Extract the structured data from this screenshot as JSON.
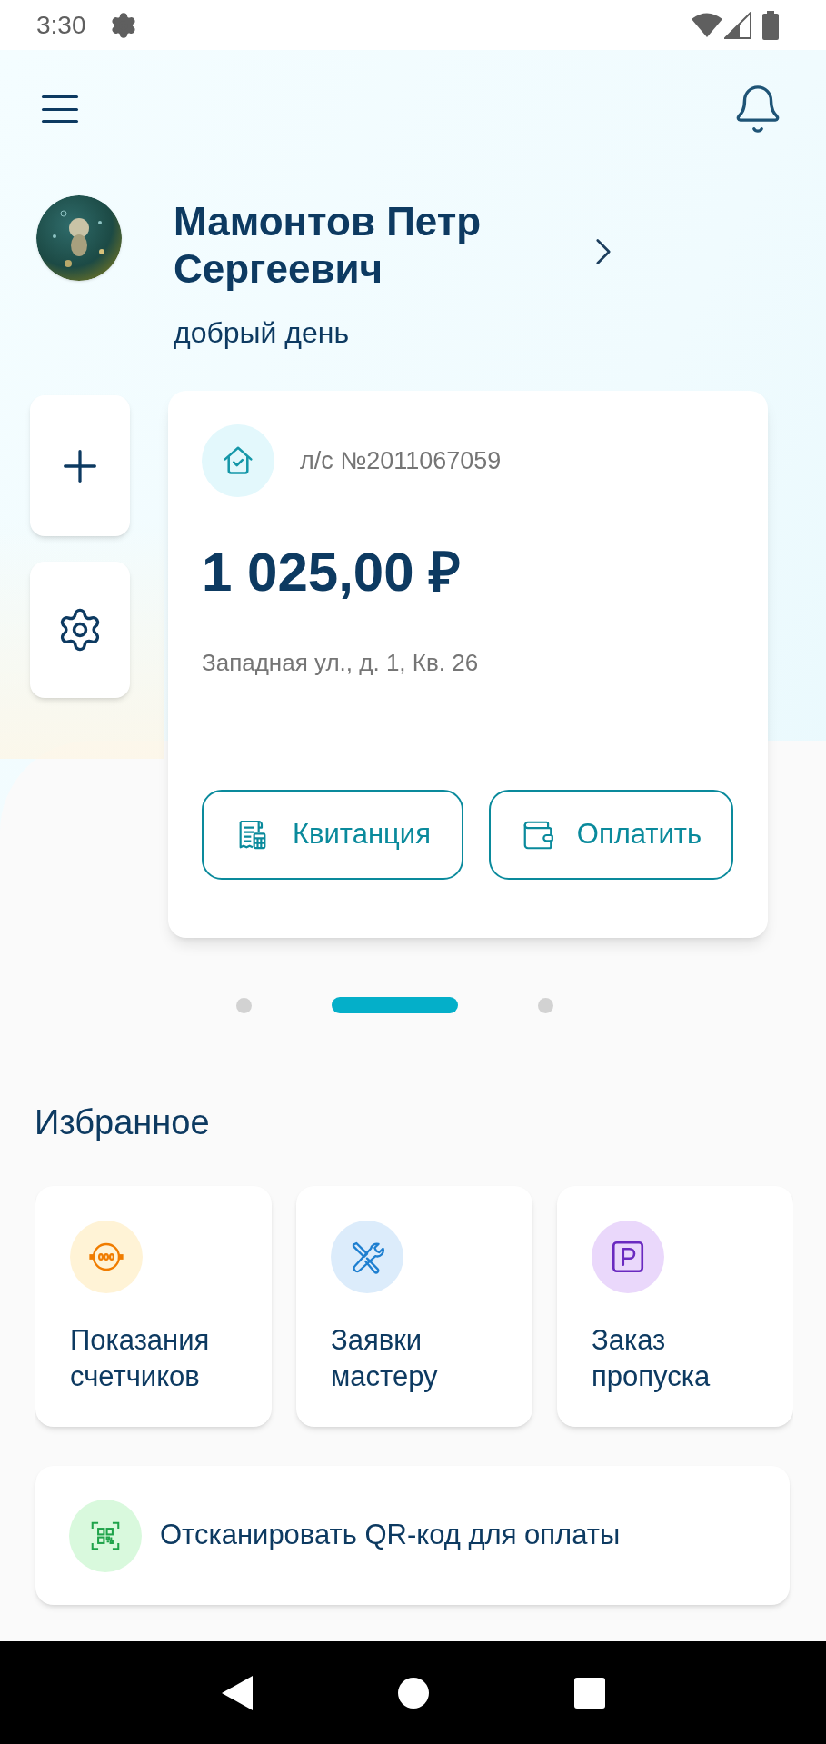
{
  "status_bar": {
    "time": "3:30"
  },
  "profile": {
    "name": "Мамонтов Петр Сергеевич",
    "greeting": "добрый день"
  },
  "account_card": {
    "account": "л/с №2011067059",
    "amount": "1 025,00 ₽",
    "address": "Западная ул., д. 1, Кв. 26",
    "buttons": [
      {
        "kind": "receipt",
        "label": "Квитанция"
      },
      {
        "kind": "wallet",
        "label": "Оплатить"
      }
    ]
  },
  "pager": [
    {
      "selected": false
    },
    {
      "selected": true
    },
    {
      "selected": false
    }
  ],
  "favorites": {
    "title": "Избранное",
    "items": [
      {
        "kind": "meter",
        "label": "Показания счетчиков"
      },
      {
        "kind": "repair",
        "label": "Заявки мастеру"
      },
      {
        "kind": "parking",
        "label": "Заказ пропуска"
      }
    ]
  },
  "qr_action": {
    "label": "Отсканировать QR-код для оплаты"
  }
}
